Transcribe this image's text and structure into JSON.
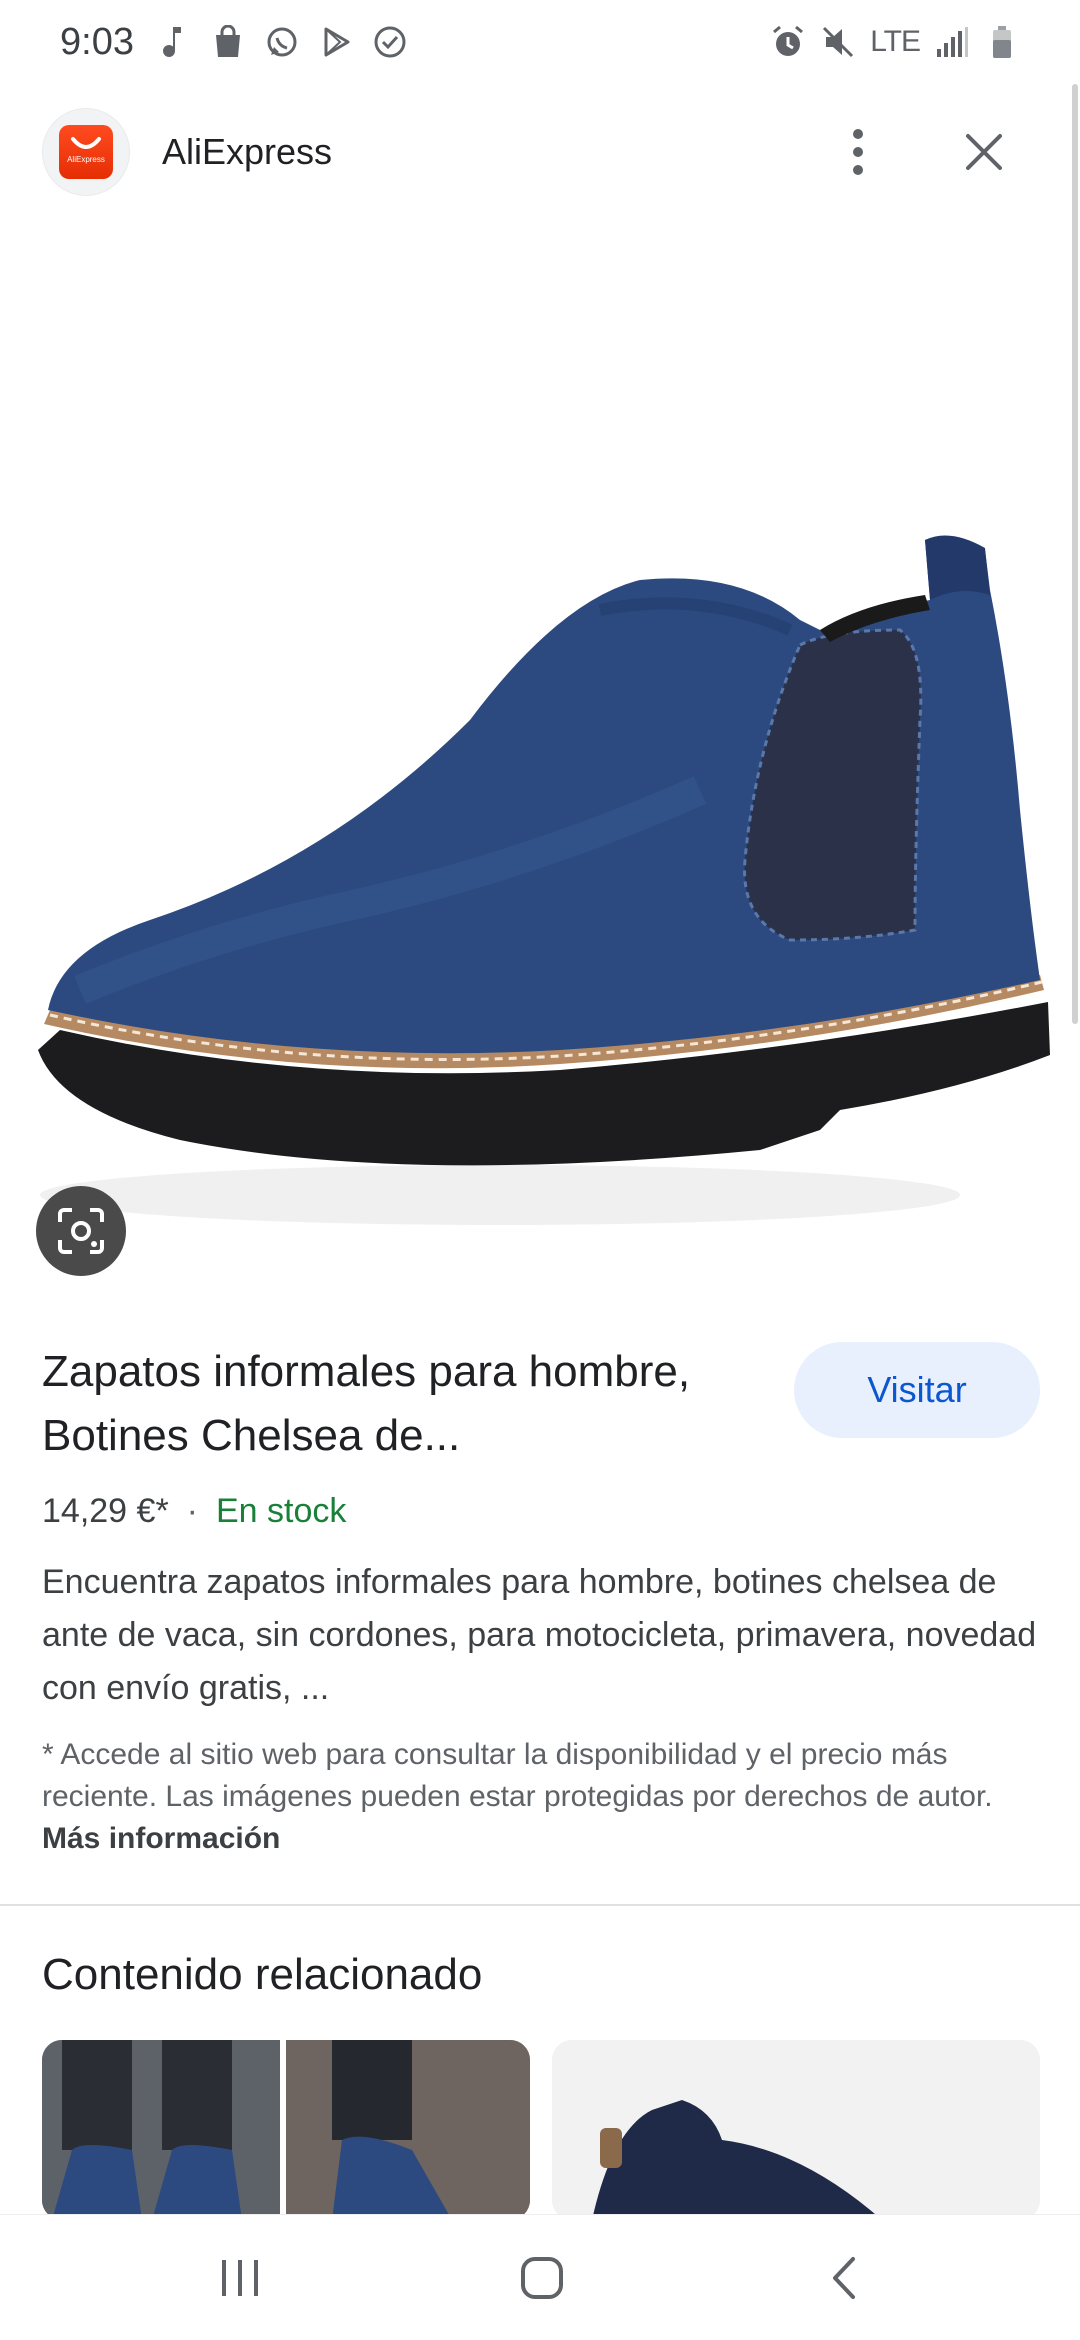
{
  "status_bar": {
    "time": "9:03",
    "network": "LTE",
    "left_icons": [
      "music-note-icon",
      "shopping-bag-icon",
      "whatsapp-icon",
      "play-store-icon",
      "check-circle-icon"
    ],
    "right_icons": [
      "alarm-icon",
      "mute-icon",
      "signal-icon",
      "battery-icon"
    ]
  },
  "header": {
    "app_name": "AliExpress",
    "logo_text": "AliExpress"
  },
  "product": {
    "title": "Zapatos informales para hombre, Botines Chelsea de...",
    "visit_label": "Visitar",
    "price": "14,29 €*",
    "separator": "·",
    "stock": "En stock",
    "description": "Encuentra zapatos informales para hombre, botines chelsea de ante de vaca, sin cordones, para motocicleta, primavera, novedad con envío gratis, ...",
    "disclaimer": "* Accede al sitio web para consultar la disponibilidad y el precio más reciente. Las imágenes pueden estar protegidas por derechos de autor.",
    "more_info": "Más información"
  },
  "related": {
    "title": "Contenido relacionado"
  },
  "colors": {
    "accent": "#0b57d0",
    "visit_bg": "#e8f0fe",
    "stock_green": "#188038",
    "logo_red": "#e62e04",
    "boot_blue": "#2c4a80"
  }
}
